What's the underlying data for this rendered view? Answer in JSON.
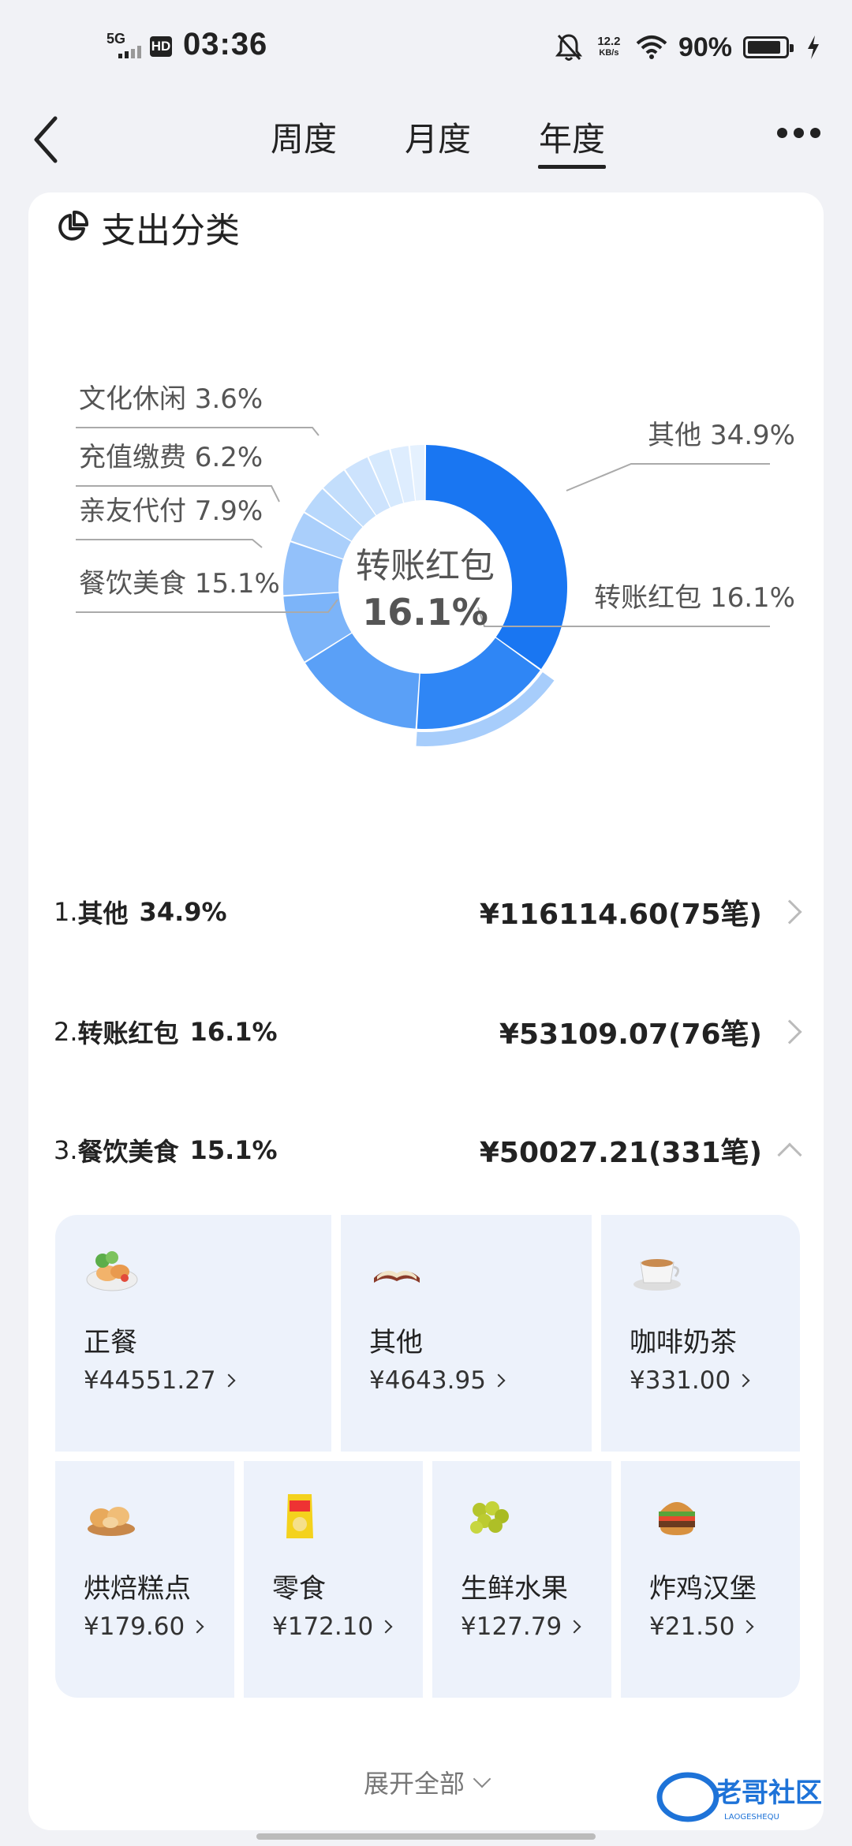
{
  "status": {
    "network": "5G",
    "hd": "HD",
    "time": "03:36",
    "speed_value": "12.2",
    "speed_unit": "KB/s",
    "battery": "90%"
  },
  "nav": {
    "tabs": [
      "周度",
      "月度",
      "年度"
    ],
    "active": 2
  },
  "section": {
    "title": "支出分类"
  },
  "chart_data": {
    "type": "pie",
    "center_label": "转账红包",
    "center_value": "16.1%",
    "slices": [
      {
        "name": "其他",
        "percent": 34.9,
        "color": "#1976f2"
      },
      {
        "name": "转账红包",
        "percent": 16.1,
        "color": "#2f86f5"
      },
      {
        "name": "餐饮美食",
        "percent": 15.1,
        "color": "#5aa0f7"
      },
      {
        "name": "亲友代付",
        "percent": 7.9,
        "color": "#7cb4f9"
      },
      {
        "name": "充值缴费",
        "percent": 6.2,
        "color": "#93c1fa"
      },
      {
        "name": "文化休闲",
        "percent": 3.6,
        "color": "#aacffb"
      },
      {
        "name": "",
        "percent": 3.4,
        "color": "#b8d8fc"
      },
      {
        "name": "",
        "percent": 3.2,
        "color": "#c3defc"
      },
      {
        "name": "",
        "percent": 3.0,
        "color": "#cde3fd"
      },
      {
        "name": "",
        "percent": 2.6,
        "color": "#d6e9fd"
      },
      {
        "name": "",
        "percent": 2.2,
        "color": "#deedfe"
      },
      {
        "name": "",
        "percent": 1.8,
        "color": "#e5f1fe"
      }
    ],
    "labels": [
      {
        "text": "文化休闲 3.6%"
      },
      {
        "text": "充值缴费 6.2%"
      },
      {
        "text": "亲友代付 7.9%"
      },
      {
        "text": "餐饮美食 15.1%"
      },
      {
        "text": "其他 34.9%"
      },
      {
        "text": "转账红包 16.1%"
      }
    ]
  },
  "ranking": [
    {
      "num": "1.",
      "name": "其他",
      "pct": "34.9%",
      "amount": "¥116114.60(75笔)"
    },
    {
      "num": "2.",
      "name": "转账红包",
      "pct": "16.1%",
      "amount": "¥53109.07(76笔)"
    },
    {
      "num": "3.",
      "name": "餐饮美食",
      "pct": "15.1%",
      "amount": "¥50027.21(331笔)"
    }
  ],
  "subcategories": [
    {
      "name": "正餐",
      "value": "¥44551.27",
      "icon": "salad-icon"
    },
    {
      "name": "其他",
      "value": "¥4643.95",
      "icon": "book-icon"
    },
    {
      "name": "咖啡奶茶",
      "value": "¥331.00",
      "icon": "coffee-icon"
    },
    {
      "name": "烘焙糕点",
      "value": "¥179.60",
      "icon": "bread-icon"
    },
    {
      "name": "零食",
      "value": "¥172.10",
      "icon": "chips-icon"
    },
    {
      "name": "生鲜水果",
      "value": "¥127.79",
      "icon": "grapes-icon"
    },
    {
      "name": "炸鸡汉堡",
      "value": "¥21.50",
      "icon": "burger-icon"
    }
  ],
  "expand_label": "展开全部",
  "watermark": {
    "main": "老哥社区",
    "sub": "LAOGESHEQU"
  }
}
